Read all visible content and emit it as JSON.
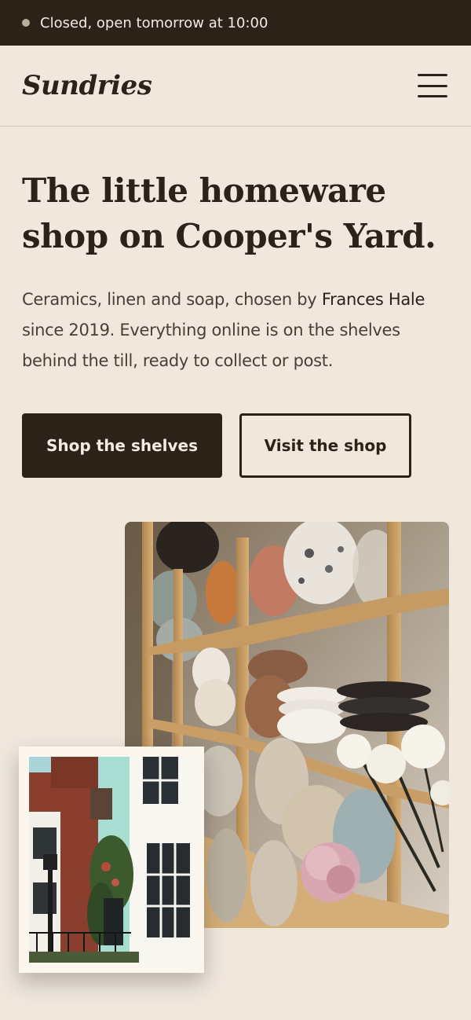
{
  "status": {
    "text": "Closed, open tomorrow at 10:00",
    "dot_color": "#b7ae9c"
  },
  "header": {
    "logo": "Sundries",
    "menu_icon": "hamburger-icon"
  },
  "hero": {
    "title_line1": "The little homeware",
    "title_line2": "shop on Cooper's Yard.",
    "desc_part1": "Ceramics, linen and soap, chosen by ",
    "desc_name": "Frances Hale",
    "desc_part2": " since 2019. Everything online is on the shelves behind the till, ready to collect or post."
  },
  "actions": {
    "primary_label": "Shop the shelves",
    "secondary_label": "Visit the shop"
  },
  "colors": {
    "background": "#f0e8dd",
    "dark": "#2d2218",
    "text": "#2d2119"
  }
}
